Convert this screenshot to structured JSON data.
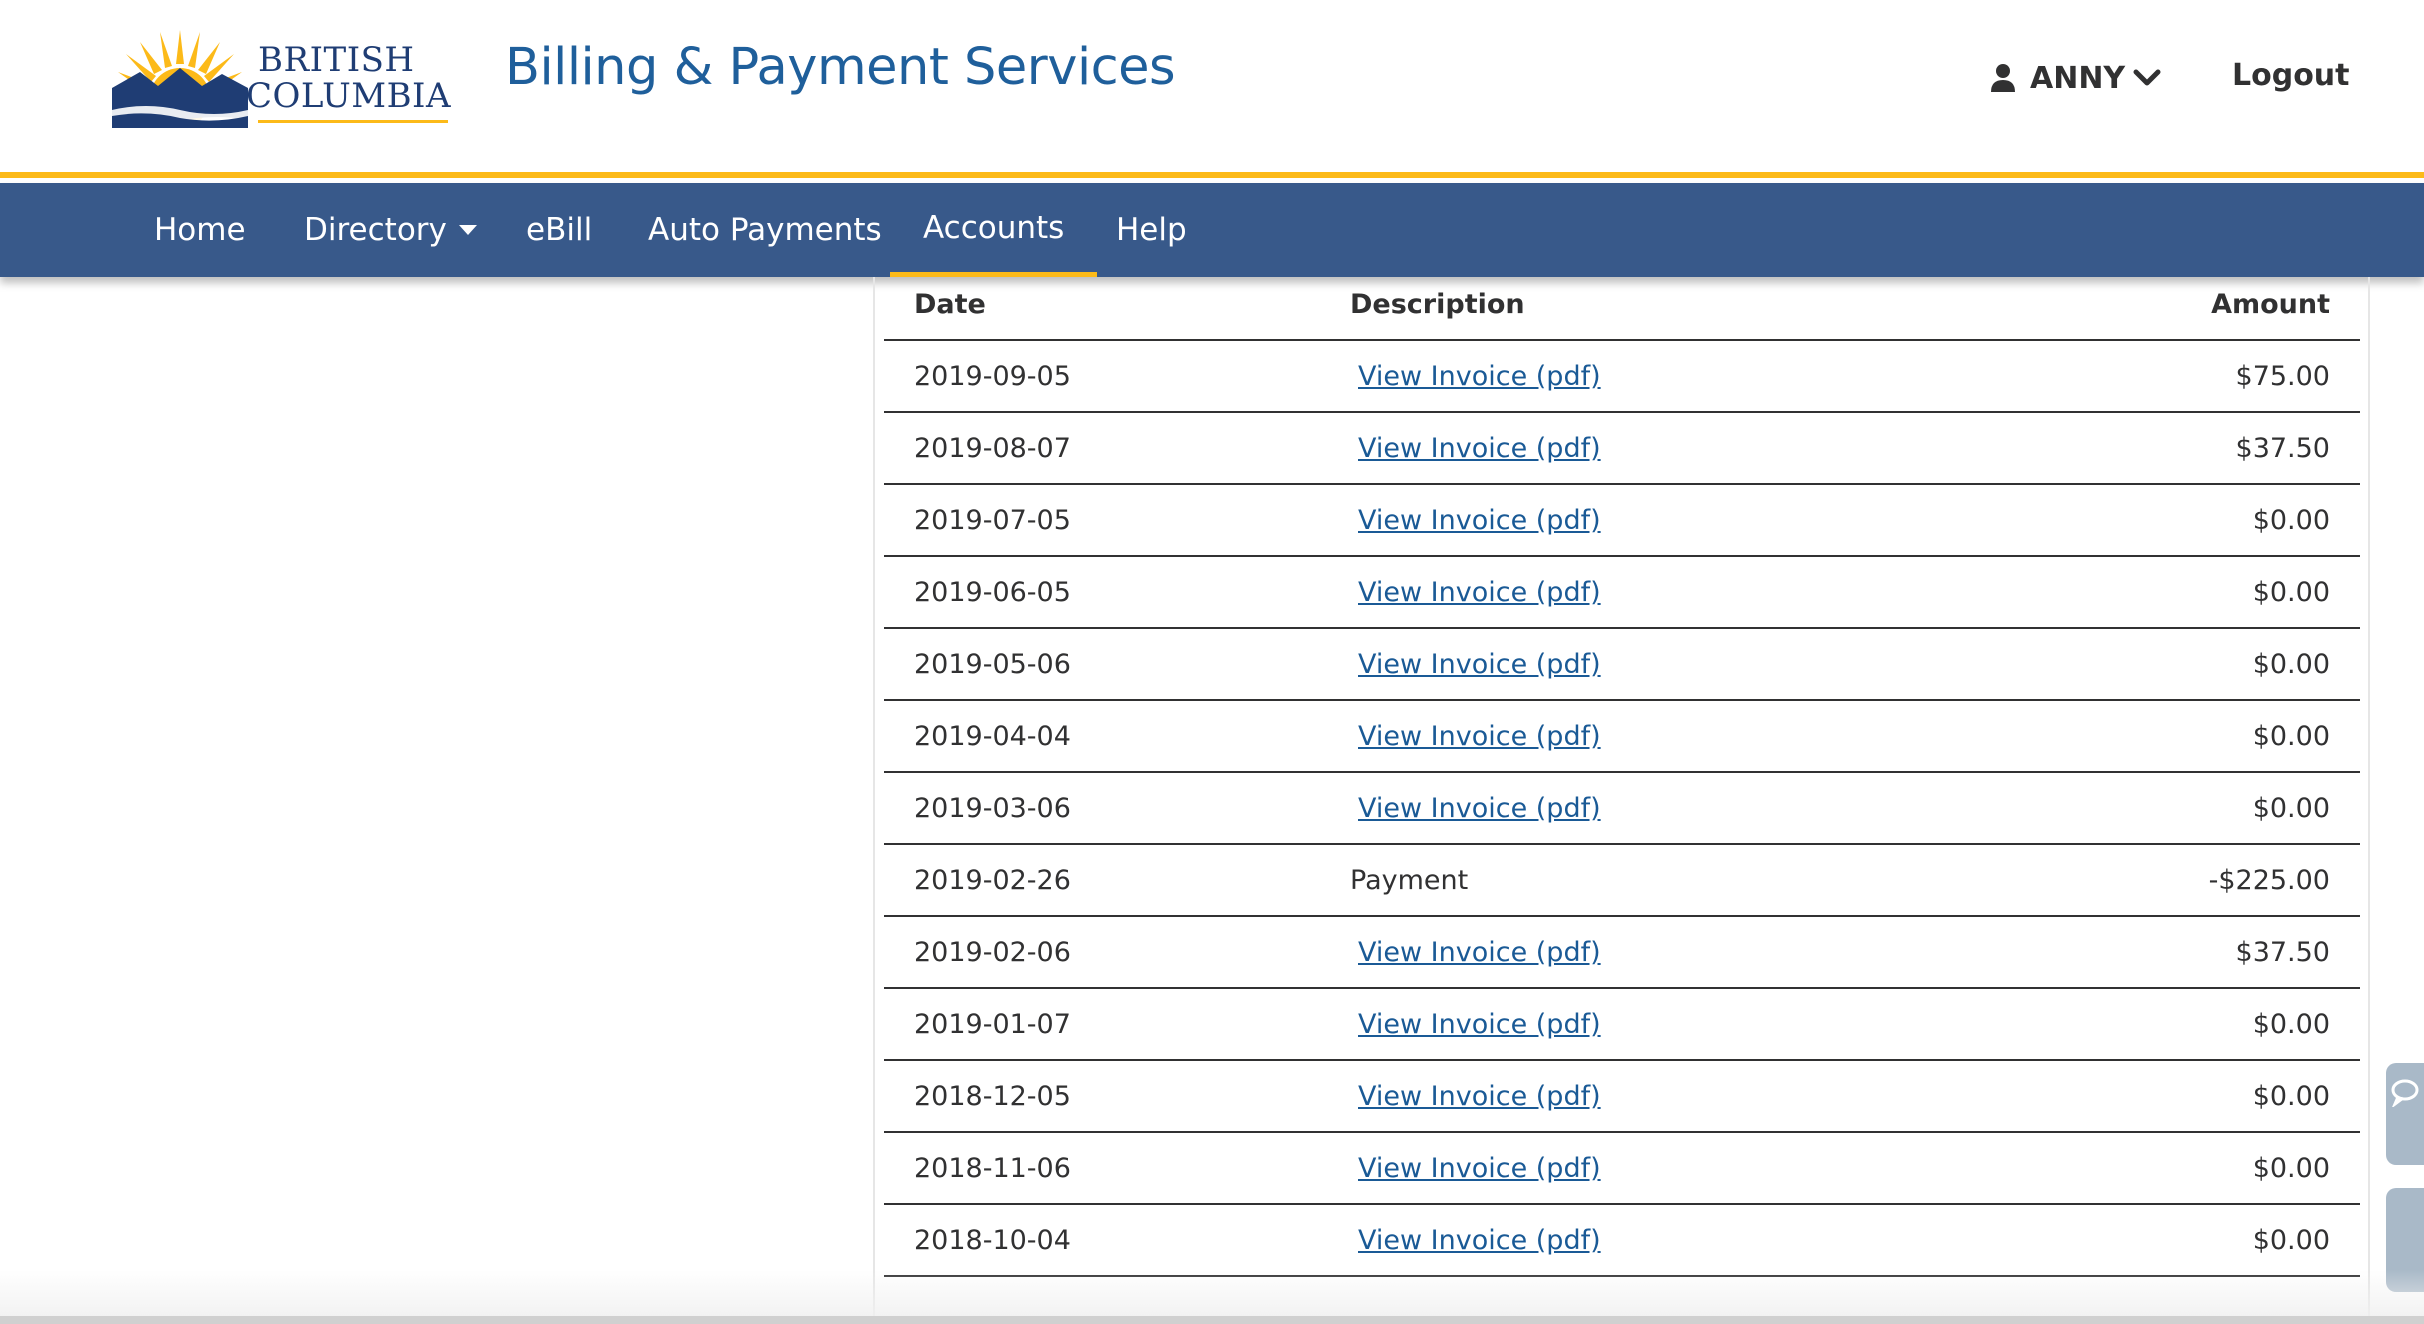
{
  "brand": {
    "logo_line1": "BRITISH",
    "logo_line2": "COLUMBIA",
    "app_title": "Billing & Payment Services"
  },
  "user": {
    "name": "ANNY",
    "logout_label": "Logout"
  },
  "nav": {
    "items": [
      {
        "label": "Home"
      },
      {
        "label": "Directory"
      },
      {
        "label": "eBill"
      },
      {
        "label": "Auto Payments"
      },
      {
        "label": "Accounts"
      },
      {
        "label": "Help"
      }
    ],
    "active": "Accounts"
  },
  "table": {
    "headers": {
      "date": "Date",
      "description": "Description",
      "amount": "Amount"
    },
    "rows": [
      {
        "date": "2019-09-05",
        "description": "View Invoice (pdf)",
        "amount": "$75.00"
      },
      {
        "date": "2019-08-07",
        "description": "View Invoice (pdf)",
        "amount": "$37.50"
      },
      {
        "date": "2019-07-05",
        "description": "View Invoice (pdf)",
        "amount": "$0.00"
      },
      {
        "date": "2019-06-05",
        "description": "View Invoice (pdf)",
        "amount": "$0.00"
      },
      {
        "date": "2019-05-06",
        "description": "View Invoice (pdf)",
        "amount": "$0.00"
      },
      {
        "date": "2019-04-04",
        "description": "View Invoice (pdf)",
        "amount": "$0.00"
      },
      {
        "date": "2019-03-06",
        "description": "View Invoice (pdf)",
        "amount": "$0.00"
      },
      {
        "date": "2019-02-26",
        "description": "Payment",
        "amount": "-$225.00"
      },
      {
        "date": "2019-02-06",
        "description": "View Invoice (pdf)",
        "amount": "$37.50"
      },
      {
        "date": "2019-01-07",
        "description": "View Invoice (pdf)",
        "amount": "$0.00"
      },
      {
        "date": "2018-12-05",
        "description": "View Invoice (pdf)",
        "amount": "$0.00"
      },
      {
        "date": "2018-11-06",
        "description": "View Invoice (pdf)",
        "amount": "$0.00"
      },
      {
        "date": "2018-10-04",
        "description": "View Invoice (pdf)",
        "amount": "$0.00"
      }
    ]
  },
  "colors": {
    "nav_bg": "#38598a",
    "accent_gold": "#fcba19",
    "brand_blue": "#1f5f9b",
    "link": "#1a5a96"
  },
  "icons": [
    "bc-sun-logo-icon",
    "user-icon",
    "chevron-down-icon",
    "caret-down-icon",
    "chat-icon"
  ]
}
